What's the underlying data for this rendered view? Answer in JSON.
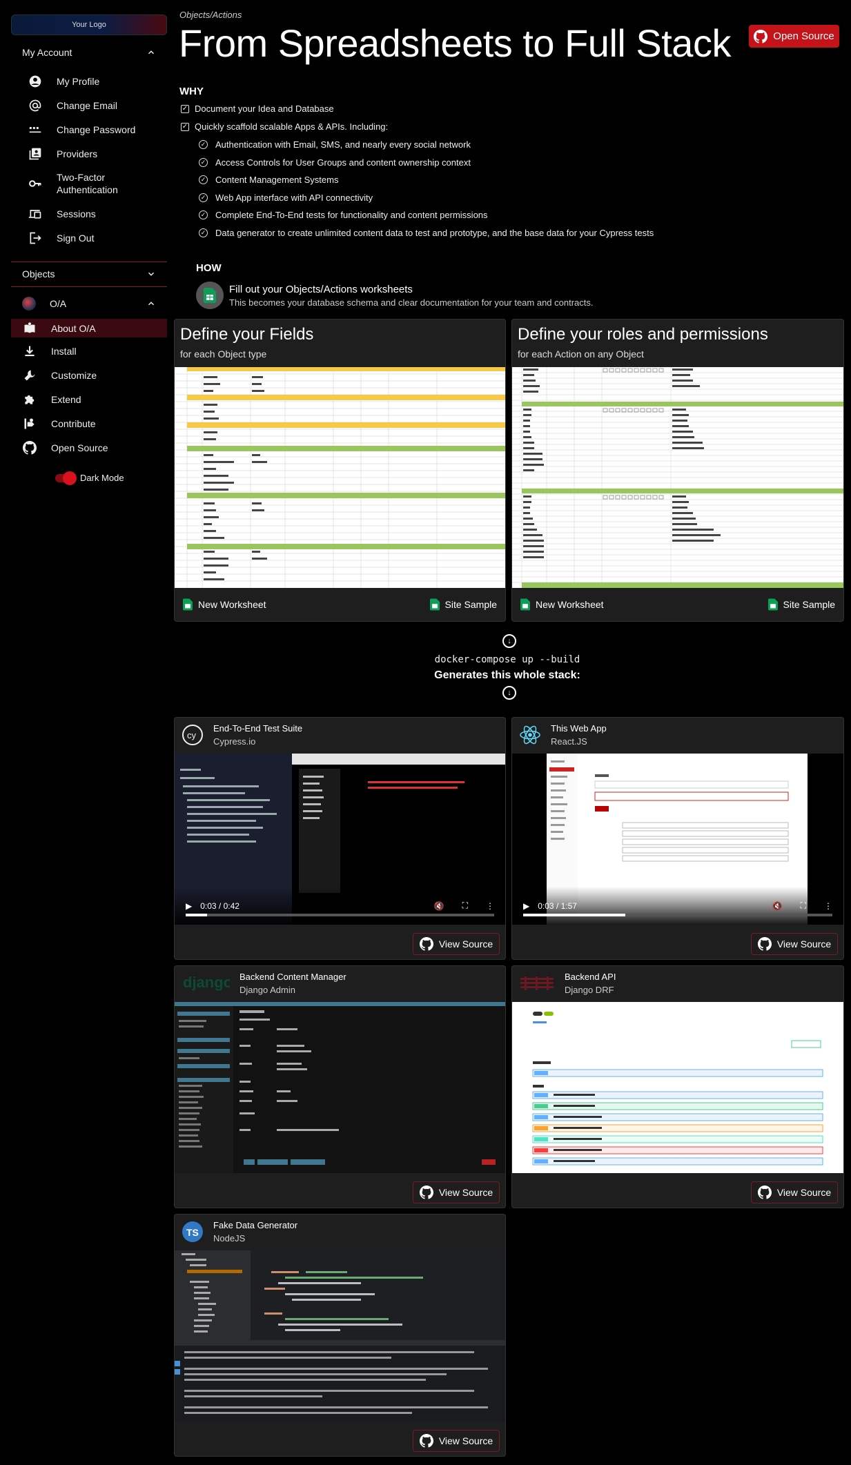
{
  "sidebar": {
    "logo": "Your Logo",
    "my_account": "My Account",
    "account_items": [
      {
        "label": "My Profile",
        "icon": "account-circle-icon"
      },
      {
        "label": "Change Email",
        "icon": "at-sign-icon"
      },
      {
        "label": "Change Password",
        "icon": "password-icon"
      },
      {
        "label": "Providers",
        "icon": "providers-icon"
      },
      {
        "label": "Two-Factor Authentication",
        "icon": "key-icon"
      },
      {
        "label": "Sessions",
        "icon": "devices-icon"
      },
      {
        "label": "Sign Out",
        "icon": "logout-icon"
      }
    ],
    "objects": "Objects",
    "oa": "O/A",
    "oa_items": [
      {
        "label": "About O/A",
        "icon": "book-icon"
      },
      {
        "label": "Install",
        "icon": "download-icon"
      },
      {
        "label": "Customize",
        "icon": "wrench-icon"
      },
      {
        "label": "Extend",
        "icon": "puzzle-icon"
      },
      {
        "label": "Contribute",
        "icon": "contribute-icon"
      },
      {
        "label": "Open Source",
        "icon": "github-icon"
      }
    ],
    "dark_mode": "Dark Mode"
  },
  "main": {
    "breadcrumb": "Objects/Actions",
    "title": "From Spreadsheets to Full Stack",
    "open_source_button": "Open Source",
    "why_heading": "WHY",
    "why_items": [
      "Document your Idea and Database",
      "Quickly scaffold scalable Apps & APIs. Including:"
    ],
    "why_sub_items": [
      "Authentication with Email, SMS, and nearly every social network",
      "Access Controls for User Groups and content ownership context",
      "Content Management Systems",
      "Web App interface with API connectivity",
      "Complete End-To-End tests for functionality and content permissions",
      "Data generator to create unlimited content data to test and prototype, and the base data for your Cypress tests"
    ],
    "how_heading": "HOW",
    "how_title": "Fill out your Objects/Actions worksheets",
    "how_sub": "This becomes your database schema and clear documentation for your team and contracts."
  },
  "worksheets": [
    {
      "title": "Define your Fields",
      "subtitle": "for each Object type",
      "new": "New Worksheet",
      "sample": "Site Sample"
    },
    {
      "title": "Define your roles and permissions",
      "subtitle": "for each Action on any Object",
      "new": "New Worksheet",
      "sample": "Site Sample"
    }
  ],
  "build": {
    "command": "docker-compose up --build",
    "generates": "Generates this whole stack:"
  },
  "projects": [
    {
      "name": "End-To-End Test Suite",
      "tech": "Cypress.io",
      "time": "0:03 / 0:42",
      "progress": 0.07,
      "view": "View Source"
    },
    {
      "name": "This Web App",
      "tech": "React.JS",
      "time": "0:03 / 1:57",
      "progress": 0.33,
      "view": "View Source"
    },
    {
      "name": "Backend Content Manager",
      "tech": "Django Admin",
      "view": "View Source"
    },
    {
      "name": "Backend API",
      "tech": "Django DRF",
      "view": "View Source"
    },
    {
      "name": "Fake Data Generator",
      "tech": "NodeJS",
      "view": "View Source"
    }
  ],
  "colors": {
    "accent": "#c4141a",
    "bg": "#000000",
    "card": "#1e1e1e",
    "sheets_green": "#0f9d58"
  }
}
